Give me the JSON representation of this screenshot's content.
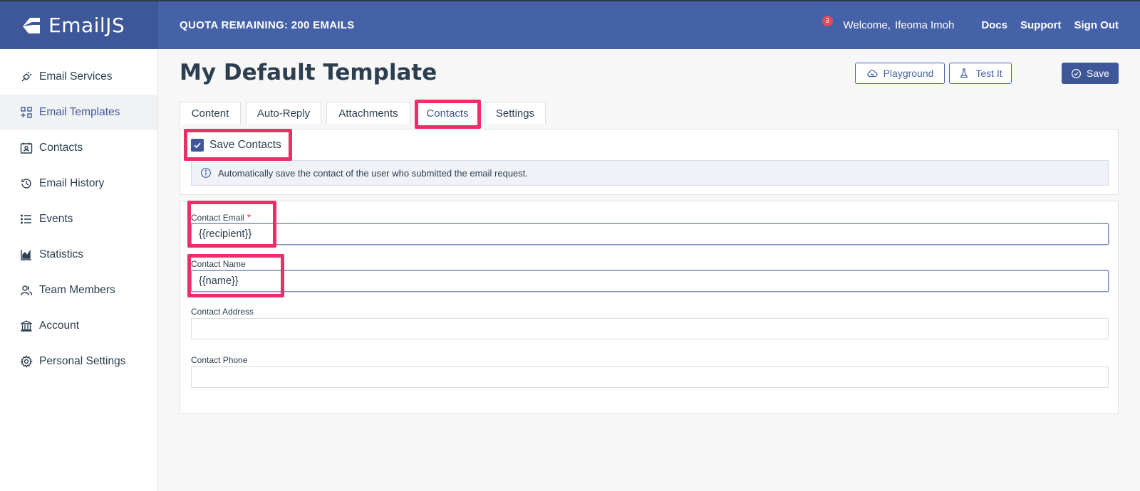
{
  "app": {
    "brand": "EmailJS",
    "quota": "QUOTA REMAINING: 200 EMAILS",
    "notification_count": "3",
    "welcome": "Welcome,",
    "username": "Ifeoma Imoh",
    "nav": [
      "Docs",
      "Support",
      "Sign Out"
    ]
  },
  "sidebar": {
    "items": [
      {
        "label": "Email Services",
        "icon": "plug-icon"
      },
      {
        "label": "Email Templates",
        "icon": "template-icon"
      },
      {
        "label": "Contacts",
        "icon": "contacts-icon"
      },
      {
        "label": "Email History",
        "icon": "history-icon"
      },
      {
        "label": "Events",
        "icon": "list-icon"
      },
      {
        "label": "Statistics",
        "icon": "chart-icon"
      },
      {
        "label": "Team Members",
        "icon": "team-icon"
      },
      {
        "label": "Account",
        "icon": "bank-icon"
      },
      {
        "label": "Personal Settings",
        "icon": "gear-icon"
      }
    ],
    "active_index": 1
  },
  "page": {
    "title": "My Default Template",
    "playground_label": "Playground",
    "testit_label": "Test It",
    "save_label": "Save"
  },
  "tabs": [
    {
      "label": "Content"
    },
    {
      "label": "Auto-Reply"
    },
    {
      "label": "Attachments"
    },
    {
      "label": "Contacts"
    },
    {
      "label": "Settings"
    }
  ],
  "active_tab": "Contacts",
  "contacts": {
    "save_contacts_label": "Save Contacts",
    "save_contacts_checked": true,
    "info_text": "Automatically save the contact of the user who submitted the email request.",
    "fields": [
      {
        "label": "Contact Email",
        "required": true,
        "value": "{{recipient}}",
        "placeholder": ""
      },
      {
        "label": "Contact Name",
        "required": false,
        "value": "{{name}}",
        "placeholder": ""
      },
      {
        "label": "Contact Address",
        "required": false,
        "value": "",
        "placeholder": ""
      },
      {
        "label": "Contact Phone",
        "required": false,
        "value": "",
        "placeholder": ""
      }
    ]
  },
  "colors": {
    "header": "#4562a8",
    "brand_bg": "#3d5799",
    "accent": "#3d5799",
    "highlight": "#ec2f69"
  }
}
